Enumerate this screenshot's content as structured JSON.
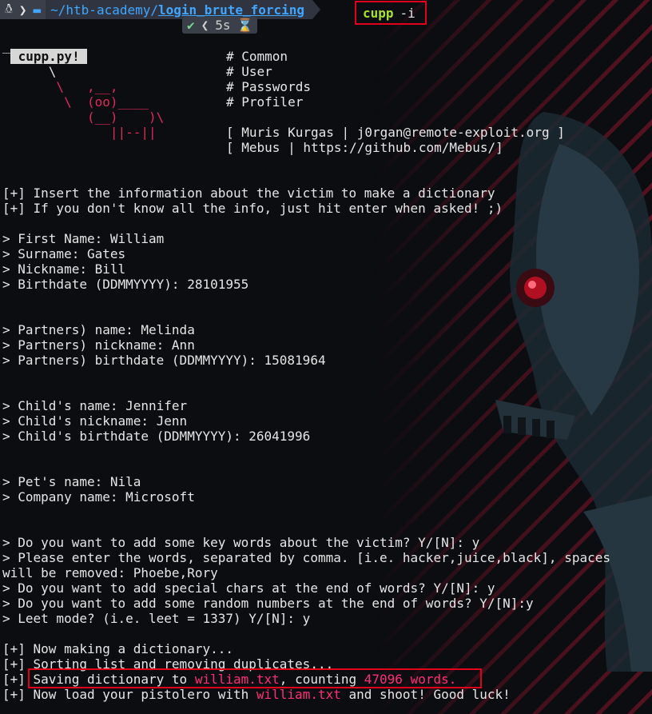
{
  "prompt": {
    "os_icon": "linux-tux-icon",
    "path_base": "~/htb-academy/",
    "path_dir": "login_brute_forcing",
    "command": "cupp",
    "command_arg": "-i",
    "status_check": "✔",
    "status_duration": "5s",
    "status_hourglass": "⌛"
  },
  "banner": {
    "dashes": "__________",
    "title": " cupp.py! ",
    "art_1": "      \\",
    "art_2": "       \\   ,__,",
    "art_3": "        \\  (oo)____",
    "art_4": "           (__)    )\\",
    "art_5": "              ||--||",
    "common": "# Common",
    "user": "# User",
    "passwords": "# Passwords",
    "profiler": "# Profiler",
    "author": "[ Muris Kurgas | j0rgan@remote-exploit.org ]",
    "github": "[ Mebus | https://github.com/Mebus/]"
  },
  "output": {
    "info_1": "[+] Insert the information about the victim to make a dictionary",
    "info_2": "[+] If you don't know all the info, just hit enter when asked! ;)",
    "first_name": "> First Name: William",
    "surname": "> Surname: Gates",
    "nickname": "> Nickname: Bill",
    "birthdate": "> Birthdate (DDMMYYYY): 28101955",
    "partner_name": "> Partners) name: Melinda",
    "partner_nick": "> Partners) nickname: Ann",
    "partner_birth": "> Partners) birthdate (DDMMYYYY): 15081964",
    "child_name": "> Child's name: Jennifer",
    "child_nick": "> Child's nickname: Jenn",
    "child_birth": "> Child's birthdate (DDMMYYYY): 26041996",
    "pet_name": "> Pet's name: Nila",
    "company": "> Company name: Microsoft",
    "keywords_q": "> Do you want to add some key words about the victim? Y/[N]: y",
    "keywords_enter": "> Please enter the words, separated by comma. [i.e. hacker,juice,black], spaces",
    "keywords_val": "will be removed: Phoebe,Rory",
    "special_chars": "> Do you want to add special chars at the end of words? Y/[N]: y",
    "random_nums": "> Do you want to add some random numbers at the end of words? Y/[N]:y",
    "leet": "> Leet mode? (i.e. leet = 1337) Y/[N]: y",
    "making": "[+] Now making a dictionary...",
    "sorting": "[+] Sorting list and removing duplicates...",
    "saving_prefix": "[+] ",
    "saving_text": "Saving dictionary to ",
    "saving_file": "william.txt",
    "saving_mid": ", counting ",
    "saving_count": "47096 words.",
    "load_prefix": "[+] Now load your pistolero with ",
    "load_file": "william.txt",
    "load_suffix": " and shoot! Good luck!"
  },
  "colors": {
    "highlight_box": "#e0001a",
    "filename": "#ff2f73",
    "banner_art": "#e02a5a",
    "command": "#a6e22e",
    "path": "#41a6ff"
  }
}
